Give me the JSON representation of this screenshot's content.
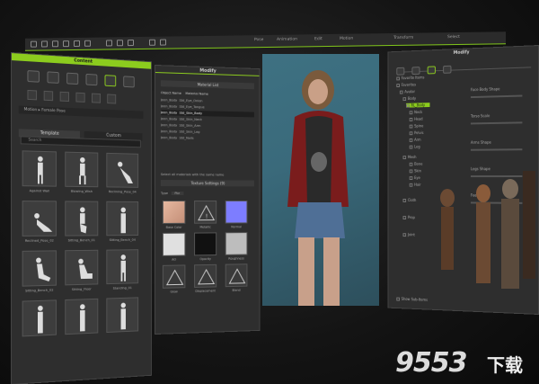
{
  "toolbar": {
    "labels": [
      "Pose",
      "Animation",
      "Edit",
      "Motion",
      "Transform",
      "Select"
    ],
    "accent": "#8ccc1e"
  },
  "content": {
    "title": "Content",
    "path_text": "Motion  ▸  Female Pose",
    "tabs": [
      "Template",
      "Custom"
    ],
    "search_placeholder": "Search",
    "thumbnails": [
      "Against Wall",
      "Blowing_Wish",
      "Reclining_Pose_04",
      "Reclined_Pose_02",
      "Sitting_Bench_01",
      "Sitting_Bench_04",
      "Sitting_Bench_02",
      "Sitting_Floor",
      "Standing_01"
    ]
  },
  "material": {
    "title": "Modify",
    "list_header": "Material List",
    "columns": [
      "Object Name",
      "Material Name"
    ],
    "rows": [
      [
        "Jeen_Body",
        "Std_Eye_Onion"
      ],
      [
        "Jeen_Body",
        "Std_Eye_Tongue"
      ],
      [
        "Jeen_Body",
        "Std_Skin_Body"
      ],
      [
        "Jeen_Body",
        "Std_Skin_Neck"
      ],
      [
        "Jeen_Body",
        "Std_Skin_Arm"
      ],
      [
        "Jeen_Body",
        "Std_Skin_Leg"
      ],
      [
        "Jeen_Body",
        "Std_Nails"
      ]
    ],
    "same_name_label": "Select all materials with the same name",
    "feature_bar": "Texture Settings (9)",
    "type_label": "Type",
    "type_value": "Pbr",
    "textures": [
      "Base Color",
      "Metallic",
      "Normal",
      "AO",
      "Opacity",
      "Roughness",
      "Glow",
      "Displacement",
      "Blend"
    ]
  },
  "scene": {
    "title": "Modify",
    "items": [
      "Favorite Items",
      "Favorites",
      "Avatar",
      "Body",
      "RL_Body",
      "Neck",
      "Head",
      "Spine",
      "Pelvis",
      "Arm",
      "Leg",
      "Hip",
      "Mesh",
      "Bone",
      "Skin",
      "Eye",
      "Hair",
      "Cloth",
      "Prop",
      "Joint"
    ],
    "sliders": [
      "Face Body Shape",
      "Torso Scale",
      "Arms Shape",
      "Legs Shape",
      "Feet"
    ],
    "footer": "Show Sub-Items"
  },
  "watermark": {
    "digits": "9553",
    "chinese": "下载"
  }
}
